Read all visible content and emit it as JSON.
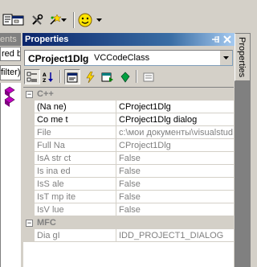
{
  "toolbar": {
    "icons": [
      "properties-page-icon",
      "dialog-icon",
      "tools-icon",
      "wizard-icon",
      "dropdown-arrow-icon",
      "smiley-icon",
      "dropdown-arrow-icon"
    ]
  },
  "left_panel": {
    "caption": "ents",
    "tab": "red b",
    "combo": "filter)"
  },
  "properties": {
    "title": "Properties",
    "object_name": "CProject1Dlg",
    "object_type": "VCCodeClass",
    "toolbar_buttons": [
      "categorized",
      "alphabetic",
      "properties-page",
      "events",
      "messages",
      "overrides",
      "property-pages"
    ],
    "categories": [
      {
        "name": "C++",
        "rows": [
          {
            "name": "(Na ne)",
            "value": "CProject1Dlg",
            "disabled": false
          },
          {
            "name": "Co me t",
            "value": "CProject1Dlg dialog",
            "disabled": false
          },
          {
            "name": "File",
            "value": "c:\\мои документы\\visualstud",
            "disabled": true
          },
          {
            "name": "Full Na",
            "value": "CProject1Dlg",
            "disabled": true
          },
          {
            "name": "IsA str ct",
            "value": "False",
            "disabled": true
          },
          {
            "name": "Is ina ed",
            "value": "False",
            "disabled": true
          },
          {
            "name": "IsS ale",
            "value": "False",
            "disabled": true
          },
          {
            "name": "IsT mp ite",
            "value": "False",
            "disabled": true
          },
          {
            "name": "IsV lue",
            "value": "False",
            "disabled": true
          }
        ]
      },
      {
        "name": "MFC",
        "rows": [
          {
            "name": "Dia gI",
            "value": "IDD_PROJECT1_DIALOG",
            "disabled": true
          }
        ]
      }
    ]
  },
  "side_tab": {
    "label": "Properties"
  },
  "colors": {
    "caption_start": "#0a246a",
    "caption_end": "#a6caf0",
    "face": "#d4d0c8"
  }
}
